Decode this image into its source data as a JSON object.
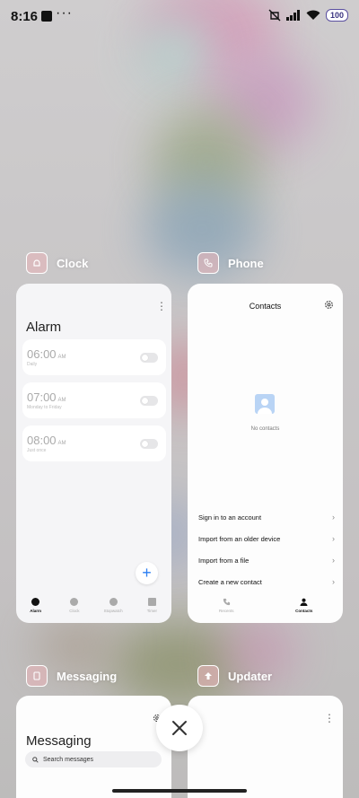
{
  "status_bar": {
    "time": "8:16",
    "dots": "···",
    "battery": "100"
  },
  "apps": {
    "clock": {
      "name": "Clock"
    },
    "phone": {
      "name": "Phone"
    },
    "messaging": {
      "name": "Messaging"
    },
    "updater": {
      "name": "Updater"
    }
  },
  "clock_card": {
    "title": "Alarm",
    "alarms": [
      {
        "time": "06:00",
        "ampm": "AM",
        "sub": "Daily"
      },
      {
        "time": "07:00",
        "ampm": "AM",
        "sub": "Monday to Friday"
      },
      {
        "time": "08:00",
        "ampm": "AM",
        "sub": "Just once"
      }
    ],
    "nav": [
      "Alarm",
      "Clock",
      "Stopwatch",
      "Timer"
    ]
  },
  "phone_card": {
    "title": "Contacts",
    "empty_text": "No contacts",
    "options": [
      "Sign in to an account",
      "Import from an older device",
      "Import from a file",
      "Create a new contact"
    ],
    "nav": [
      "Recents",
      "Contacts"
    ]
  },
  "messaging_card": {
    "title": "Messaging",
    "search_placeholder": "Search messages"
  },
  "colors": {
    "accent": "#2a7ef2",
    "background": "#c9c7c8"
  }
}
